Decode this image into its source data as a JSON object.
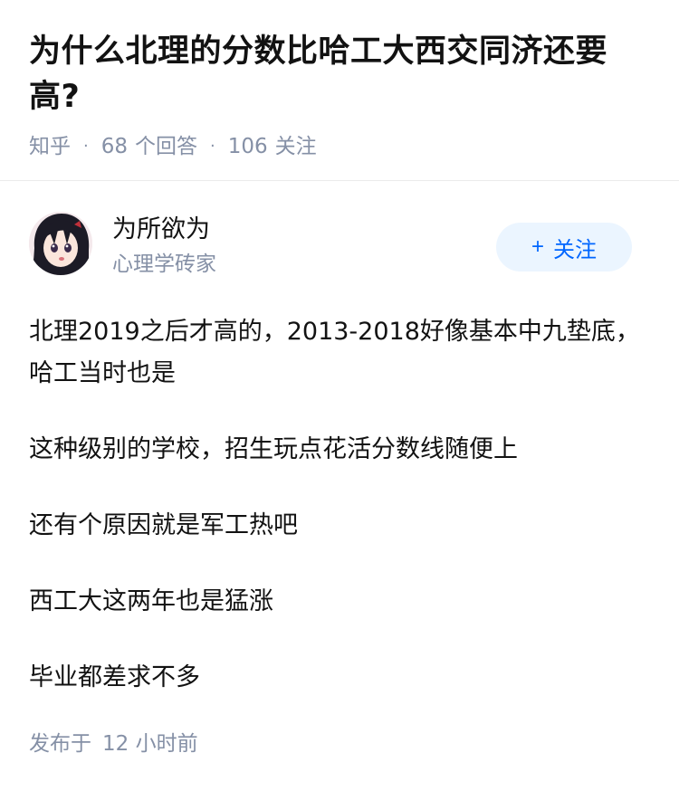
{
  "question": {
    "title": "为什么北理的分数比哈工大西交同济还要高?",
    "meta": {
      "source": "知乎",
      "answers_count": "68",
      "answers_label": "个回答",
      "followers_count": "106",
      "followers_label": "关注"
    }
  },
  "answer": {
    "author": {
      "name": "为所欲为",
      "bio": "心理学砖家",
      "follow_label": "关注",
      "follow_icon": "plus-icon"
    },
    "paragraphs": [
      "北理2019之后才高的，2013-2018好像基本中九垫底，哈工当时也是",
      "这种级别的学校，招生玩点花活分数线随便上",
      "还有个原因就是军工热吧",
      "西工大这两年也是猛涨",
      "毕业都差求不多"
    ],
    "footer": {
      "published_label": "发布于",
      "published_time": "12 小时前"
    }
  },
  "colors": {
    "text": "#121212",
    "meta": "#8590a6",
    "accent": "#0066ff",
    "follow_bg": "#ebf5ff"
  }
}
